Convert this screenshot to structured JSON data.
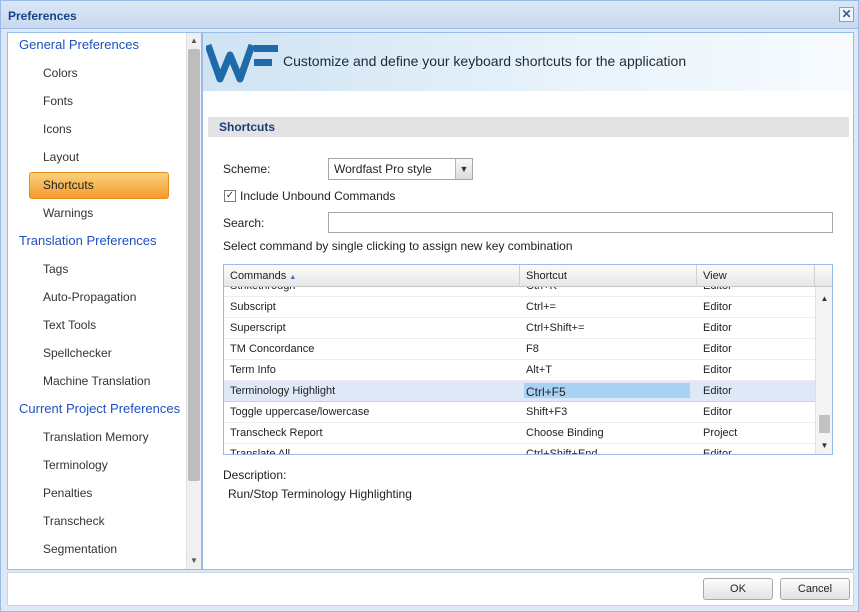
{
  "window": {
    "title": "Preferences",
    "close_glyph": "✕"
  },
  "sidebar": {
    "groups": [
      {
        "label": "General Preferences",
        "items": [
          "Colors",
          "Fonts",
          "Icons",
          "Layout",
          "Shortcuts",
          "Warnings"
        ]
      },
      {
        "label": "Translation Preferences",
        "items": [
          "Tags",
          "Auto-Propagation",
          "Text Tools",
          "Spellchecker",
          "Machine Translation"
        ]
      },
      {
        "label": "Current Project Preferences",
        "items": [
          "Translation Memory",
          "Terminology",
          "Penalties",
          "Transcheck",
          "Segmentation"
        ]
      }
    ],
    "selected": "Shortcuts",
    "scroll_up_glyph": "▲",
    "scroll_down_glyph": "▼"
  },
  "banner": {
    "logo_icon": "wf-logo-icon",
    "text": "Customize and define your keyboard shortcuts for the application",
    "accent": "#1f6aa8"
  },
  "section": {
    "title": "Shortcuts"
  },
  "form": {
    "scheme_label": "Scheme:",
    "scheme_value": "Wordfast Pro style",
    "include_unbound_label": "Include Unbound Commands",
    "include_unbound_checked": true,
    "search_label": "Search:",
    "search_value": "",
    "hint": "Select command by single clicking to assign new key combination"
  },
  "grid": {
    "columns": [
      "Commands",
      "Shortcut",
      "View"
    ],
    "sort_glyph": "▲",
    "rows": [
      {
        "command": "Strikethrough",
        "shortcut": "Ctrl+K",
        "view": "Editor"
      },
      {
        "command": "Subscript",
        "shortcut": "Ctrl+=",
        "view": "Editor"
      },
      {
        "command": "Superscript",
        "shortcut": "Ctrl+Shift+=",
        "view": "Editor"
      },
      {
        "command": "TM Concordance",
        "shortcut": "F8",
        "view": "Editor"
      },
      {
        "command": "Term Info",
        "shortcut": "Alt+T",
        "view": "Editor"
      },
      {
        "command": "Terminology Highlight",
        "shortcut": "Ctrl+F5",
        "view": "Editor"
      },
      {
        "command": "Toggle uppercase/lowercase",
        "shortcut": "Shift+F3",
        "view": "Editor"
      },
      {
        "command": "Transcheck Report",
        "shortcut": "Choose Binding",
        "view": "Project"
      },
      {
        "command": "Translate All",
        "shortcut": "Ctrl+Shift+End",
        "view": "Editor"
      }
    ],
    "selected_index": 5,
    "scroll_up_glyph": "▲",
    "scroll_down_glyph": "▼"
  },
  "description": {
    "label": "Description:",
    "text": "Run/Stop Terminology Highlighting"
  },
  "footer": {
    "ok_label": "OK",
    "cancel_label": "Cancel"
  },
  "colors": {
    "selected_nav": "#f39b2d",
    "link": "#1e4fc2",
    "selected_row": "#dfe8f6",
    "edit_highlight": "#a9d3f5"
  }
}
